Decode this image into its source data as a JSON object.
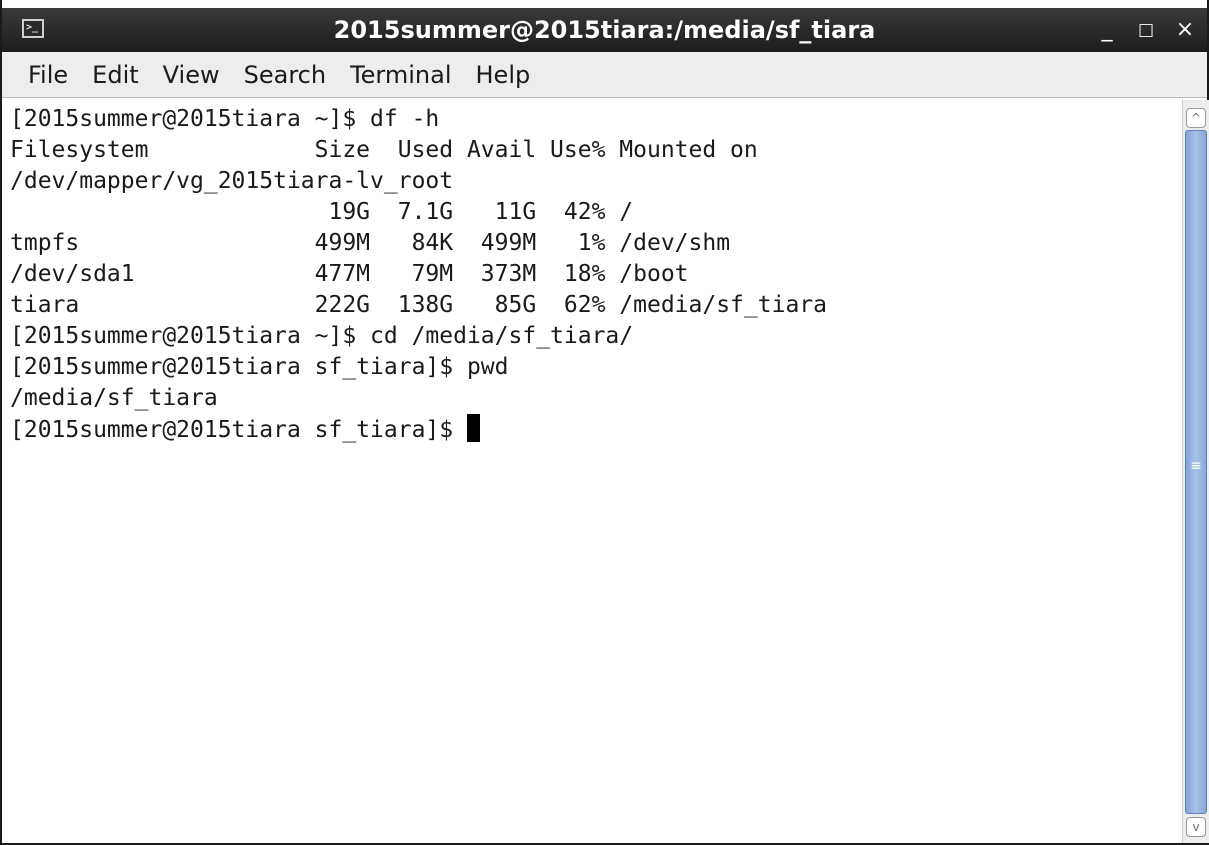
{
  "window": {
    "title": "2015summer@2015tiara:/media/sf_tiara",
    "minimize_glyph": "_",
    "maximize_glyph": "□",
    "close_glyph": "×",
    "app_icon": "terminal-icon"
  },
  "menubar": {
    "items": [
      {
        "label": "File"
      },
      {
        "label": "Edit"
      },
      {
        "label": "View"
      },
      {
        "label": "Search"
      },
      {
        "label": "Terminal"
      },
      {
        "label": "Help"
      }
    ]
  },
  "terminal": {
    "lines": [
      "[2015summer@2015tiara ~]$ df -h",
      "Filesystem            Size  Used Avail Use% Mounted on",
      "/dev/mapper/vg_2015tiara-lv_root",
      "                       19G  7.1G   11G  42% /",
      "tmpfs                 499M   84K  499M   1% /dev/shm",
      "/dev/sda1             477M   79M  373M  18% /boot",
      "tiara                 222G  138G   85G  62% /media/sf_tiara",
      "[2015summer@2015tiara ~]$ cd /media/sf_tiara/",
      "[2015summer@2015tiara sf_tiara]$ pwd",
      "/media/sf_tiara"
    ],
    "prompt": "[2015summer@2015tiara sf_tiara]$ "
  },
  "scrollbar": {
    "up_arrow": "^",
    "down_arrow": "v",
    "grip": "≡"
  },
  "colors": {
    "titlebar": "#1c1c1c",
    "menubar": "#ededed",
    "scroll_thumb": "#a9c3e8",
    "text": "#1a1a1a"
  }
}
